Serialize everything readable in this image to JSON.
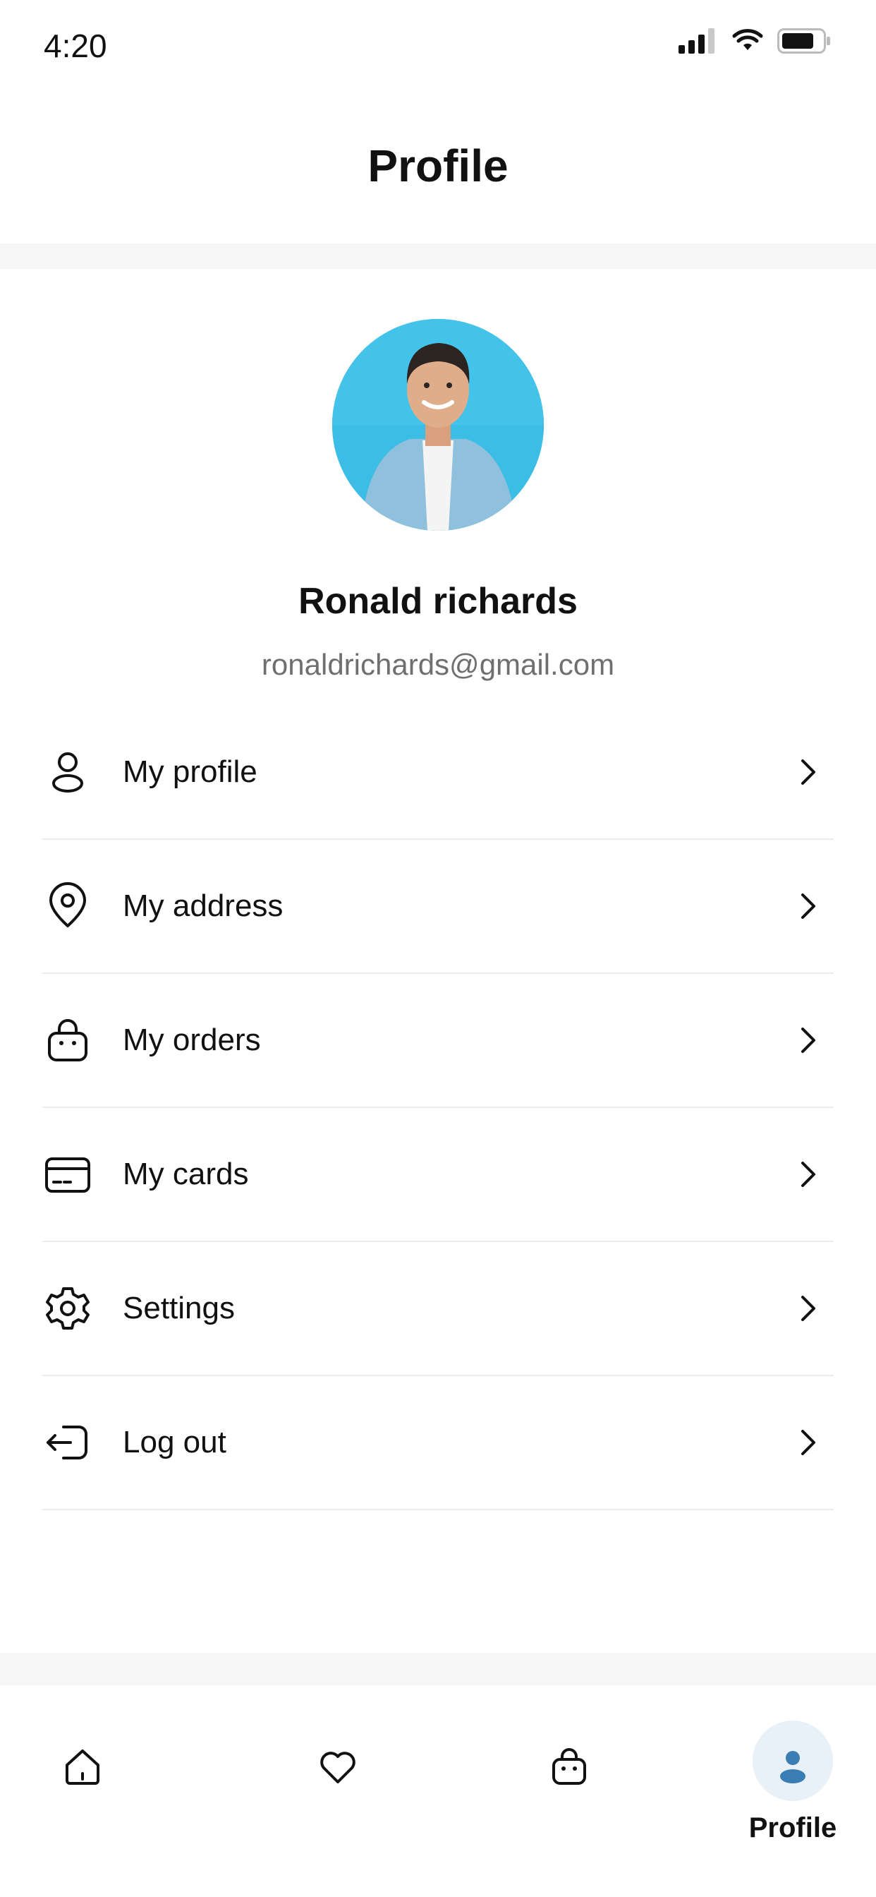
{
  "status_bar": {
    "time": "4:20"
  },
  "header": {
    "title": "Profile"
  },
  "user": {
    "name": "Ronald richards",
    "email": "ronaldrichards@gmail.com"
  },
  "menu": [
    {
      "label": "My profile",
      "icon": "user-icon"
    },
    {
      "label": "My address",
      "icon": "location-pin-icon"
    },
    {
      "label": "My orders",
      "icon": "shopping-bag-icon"
    },
    {
      "label": "My cards",
      "icon": "credit-card-icon"
    },
    {
      "label": "Settings",
      "icon": "gear-icon"
    },
    {
      "label": "Log out",
      "icon": "logout-icon"
    }
  ],
  "bottom_nav": {
    "items": [
      {
        "icon": "home-icon"
      },
      {
        "icon": "heart-icon"
      },
      {
        "icon": "shopping-bag-icon"
      },
      {
        "icon": "profile-icon",
        "label": "Profile",
        "active": true
      }
    ]
  },
  "colors": {
    "accent": "#3a7db3",
    "active_bg": "#e8f1f7",
    "avatar_bg": "#3cbde6"
  }
}
